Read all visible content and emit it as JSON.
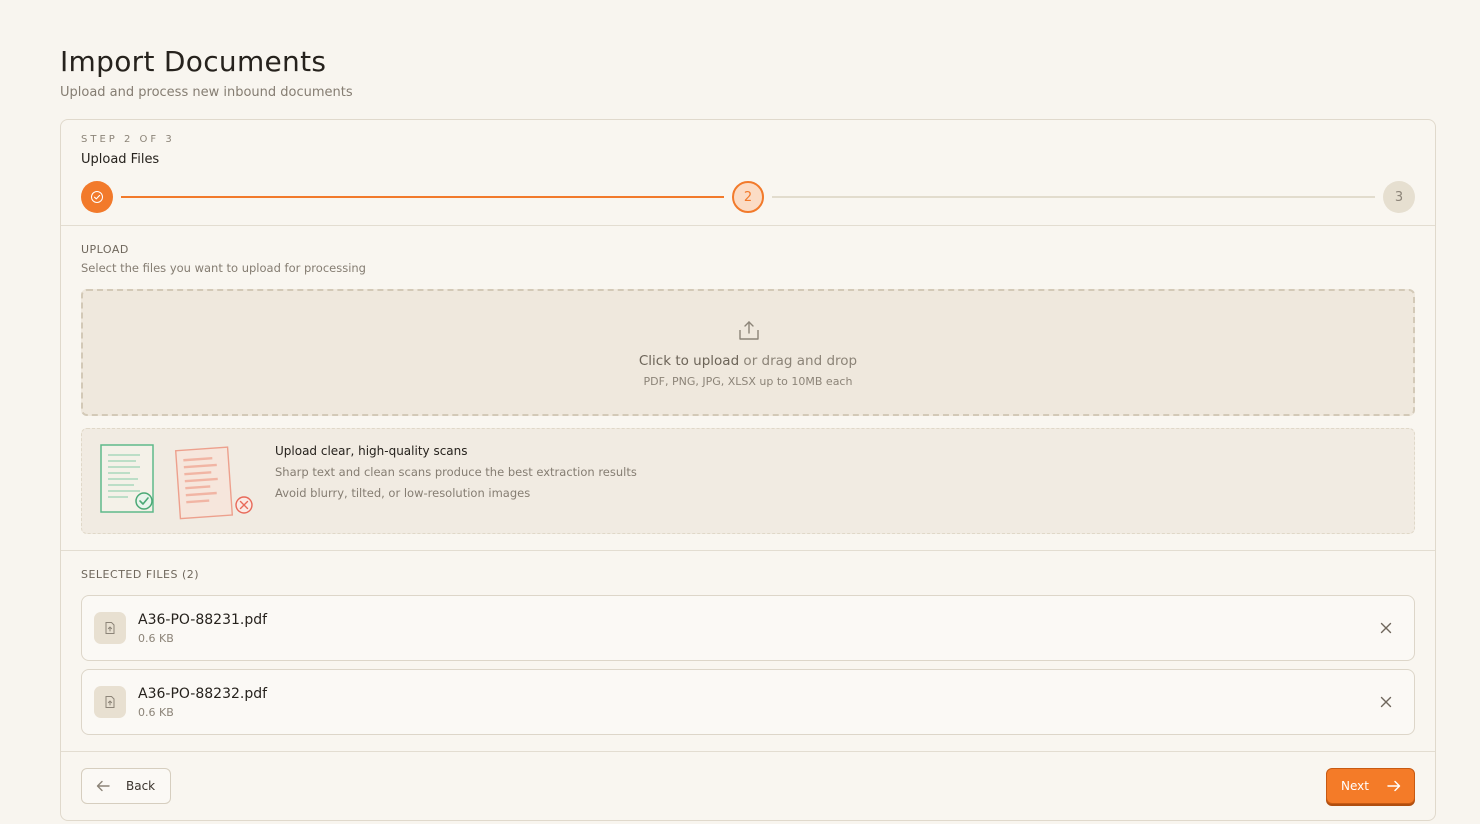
{
  "page": {
    "title": "Import Documents",
    "subtitle": "Upload and process new inbound documents"
  },
  "wizard": {
    "step_kicker": "STEP 2 OF 3",
    "step_title": "Upload Files",
    "steps": [
      {
        "label": "",
        "state": "done"
      },
      {
        "label": "2",
        "state": "current"
      },
      {
        "label": "3",
        "state": "todo"
      }
    ],
    "accent_color": "#f27a2b"
  },
  "upload": {
    "label": "UPLOAD",
    "description": "Select the files you want to upload for processing",
    "dropzone": {
      "primary_strong": "Click to upload",
      "primary_rest": " or drag and drop",
      "formats": "PDF, PNG, JPG, XLSX up to 10MB each",
      "icon": "upload-icon"
    },
    "tip": {
      "title": "Upload clear, high-quality scans",
      "line1": "Sharp text and clean scans produce the best extraction results",
      "line2": "Avoid blurry, tilted, or low-resolution images"
    }
  },
  "files": {
    "label": "SELECTED FILES (2)",
    "items": [
      {
        "name": "A36-PO-88231.pdf",
        "size": "0.6 KB"
      },
      {
        "name": "A36-PO-88232.pdf",
        "size": "0.6 KB"
      }
    ]
  },
  "footer": {
    "back_label": "Back",
    "next_label": "Next"
  }
}
